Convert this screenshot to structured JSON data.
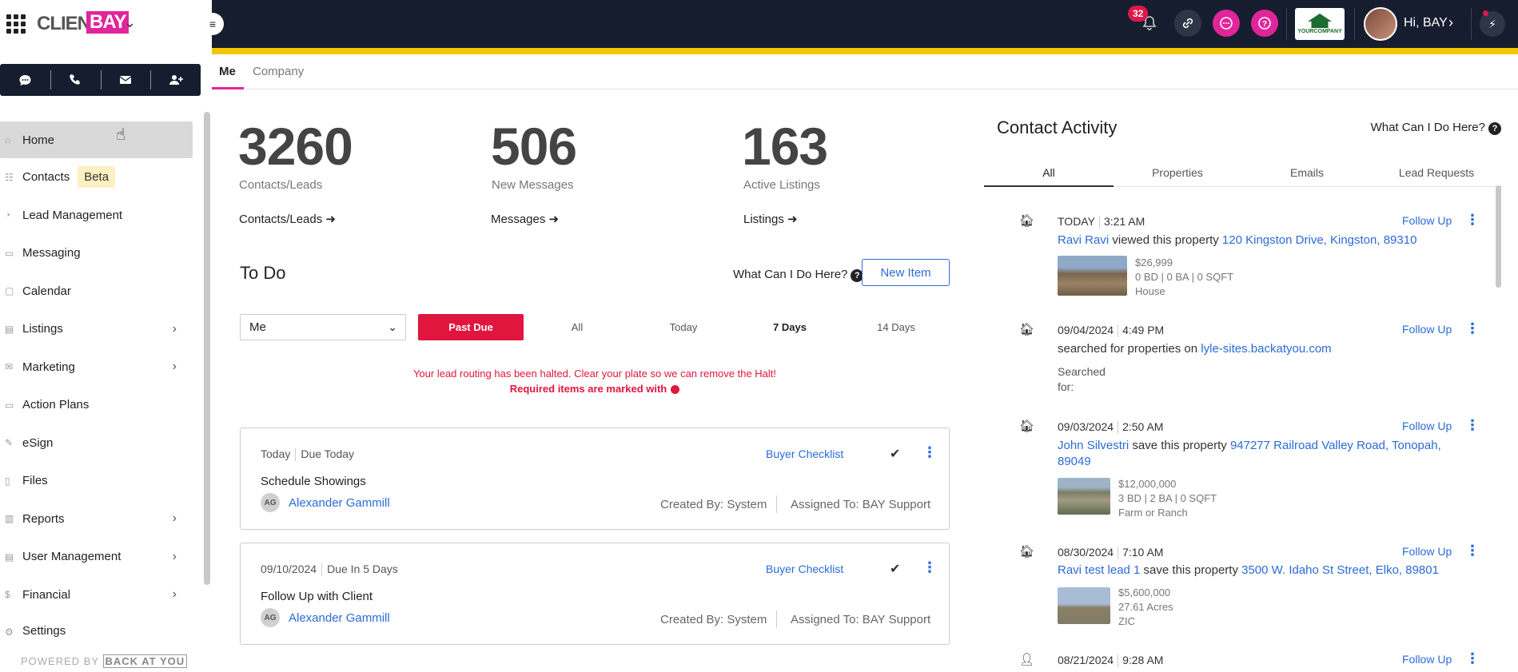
{
  "brand": {
    "client": "CLIENT",
    "bay": "BAY"
  },
  "quickbar": {
    "icons": [
      "chat-icon",
      "phone-icon",
      "mail-icon",
      "add-user-icon"
    ]
  },
  "sidebar": {
    "items": [
      {
        "label": "Home",
        "icon": "home-icon"
      },
      {
        "label": "Contacts",
        "badge": "Beta",
        "icon": "contacts-icon"
      },
      {
        "label": "Lead Management",
        "icon": "lead-icon"
      },
      {
        "label": "Messaging",
        "icon": "message-icon"
      },
      {
        "label": "Calendar",
        "icon": "calendar-icon"
      },
      {
        "label": "Listings",
        "icon": "listings-icon"
      },
      {
        "label": "Marketing",
        "icon": "marketing-icon"
      },
      {
        "label": "Action Plans",
        "icon": "action-plans-icon"
      },
      {
        "label": "eSign",
        "icon": "esign-icon"
      },
      {
        "label": "Files",
        "icon": "files-icon"
      },
      {
        "label": "Reports",
        "icon": "reports-icon"
      },
      {
        "label": "User Management",
        "icon": "user-management-icon"
      },
      {
        "label": "Financial",
        "icon": "financial-icon"
      },
      {
        "label": "Settings",
        "icon": "settings-icon"
      }
    ],
    "powered_by": "POWERED BY",
    "powered_brand": "BACK AT YOU"
  },
  "topbar": {
    "notifications": "32",
    "greeting": "Hi, BAY",
    "logo_text": "YOURCOMPANY"
  },
  "tabs": {
    "me": "Me",
    "company": "Company"
  },
  "stats": [
    {
      "value": "3260",
      "label": "Contacts/Leads",
      "link": "Contacts/Leads"
    },
    {
      "value": "506",
      "label": "New Messages",
      "link": "Messages"
    },
    {
      "value": "163",
      "label": "Active Listings",
      "link": "Listings"
    }
  ],
  "todo": {
    "title": "To Do",
    "help": "What Can I Do Here?",
    "new_item": "New Item",
    "owner_select": "Me",
    "filters": [
      "Past Due",
      "All",
      "Today",
      "7 Days",
      "14 Days"
    ],
    "halt_message": "Your lead routing has been halted. Clear your plate so we can remove the Halt!",
    "required_message": "Required items are marked with",
    "cards": [
      {
        "date": "Today",
        "due": "Due Today",
        "checklist": "Buyer Checklist",
        "title": "Schedule Showings",
        "initials": "AG",
        "contact": "Alexander Gammill",
        "created": "Created By: System",
        "assigned": "Assigned To: BAY Support"
      },
      {
        "date": "09/10/2024",
        "due": "Due In 5 Days",
        "checklist": "Buyer Checklist",
        "title": "Follow Up with Client",
        "initials": "AG",
        "contact": "Alexander Gammill",
        "created": "Created By: System",
        "assigned": "Assigned To: BAY Support"
      }
    ]
  },
  "activity": {
    "title": "Contact Activity",
    "help": "What Can I Do Here?",
    "tabs": [
      "All",
      "Properties",
      "Emails",
      "Lead Requests"
    ],
    "follow_up": "Follow Up",
    "items": [
      {
        "date": "TODAY",
        "time": "3:21 AM",
        "who": "Ravi Ravi",
        "action": " viewed this property ",
        "target": "120 Kingston Drive, Kingston, 89310",
        "price": "$26,999",
        "details": "0 BD | 0 BA | 0 SQFT",
        "type": "House"
      },
      {
        "date": "09/04/2024",
        "time": "4:49 PM",
        "action": "searched for properties on ",
        "target": "lyle-sites.backatyou.com",
        "searched": "Searched",
        "searched_for": "for:"
      },
      {
        "date": "09/03/2024",
        "time": "2:50 AM",
        "who": "John Silvestri",
        "action": " save this property ",
        "target": "947277 Railroad Valley Road, Tonopah,",
        "target2": "89049",
        "price": "$12,000,000",
        "details": "3 BD | 2 BA | 0 SQFT",
        "type": "Farm or Ranch"
      },
      {
        "date": "08/30/2024",
        "time": "7:10 AM",
        "who": "Ravi test lead 1",
        "action": " save this property ",
        "target": "3500 W. Idaho St Street, Elko, 89801",
        "price": "$5,600,000",
        "details": "27.61 Acres",
        "type": "ZIC"
      },
      {
        "date": "08/21/2024",
        "time": "9:28 AM"
      }
    ]
  },
  "colors": {
    "brand_pink": "#e0259a",
    "topbar": "#161d2e",
    "accent_yellow": "#f5c400",
    "alert_red": "#e0163e",
    "link_blue": "#2b6bd6"
  }
}
